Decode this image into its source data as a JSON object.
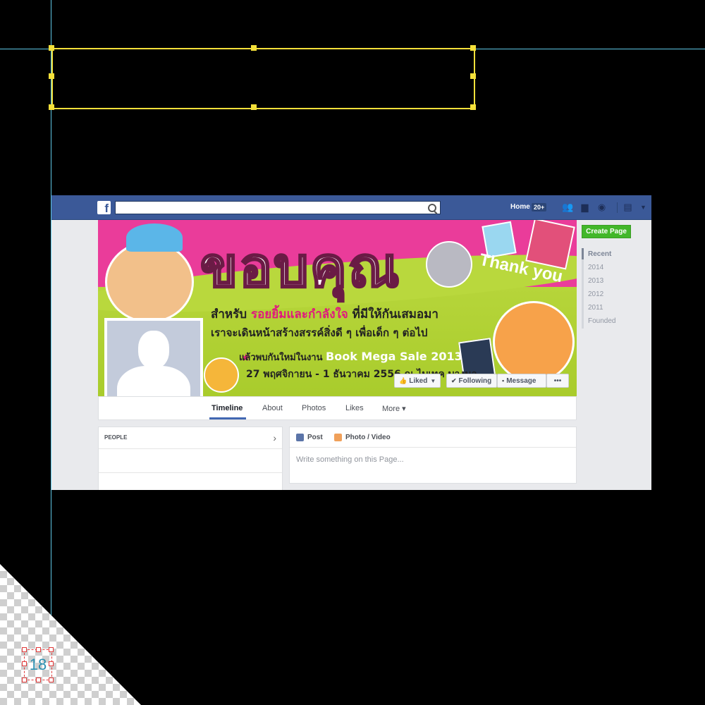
{
  "facebook": {
    "search": {
      "placeholder": ""
    },
    "nav": {
      "home": "Home",
      "badge": "20+"
    },
    "cover": {
      "headline": "ขอบคุณ",
      "thank_you": "Thank you",
      "line1_a": "สำหรับ ",
      "line1_b": "รอยยิ้มและกำลังใจ",
      "line1_c": " ที่มีให้กันเสมอมา",
      "line2": "เราจะเดินหน้าสร้างสรรค์สิ่งดี ๆ เพื่อเด็ก ๆ ต่อไป",
      "line3_a": "แล้วพบกันใหม่ในงาน ",
      "line3_b": "Book Mega Sale 2013",
      "line4": "27 พฤศจิกายน - 1 ธันวาคม 2556 ณ ไบเทค บางนา"
    },
    "buttons": {
      "liked": "Liked",
      "following": "Following",
      "message": "Message",
      "more_dots": "•••"
    },
    "tabs": [
      "Timeline",
      "About",
      "Photos",
      "Likes",
      "More ▾"
    ],
    "people": {
      "title": "PEOPLE"
    },
    "composer": {
      "post": "Post",
      "photo_video": "Photo / Video",
      "placeholder": "Write something on this Page..."
    },
    "sidebar": {
      "create_page": "Create Page",
      "years": [
        "Recent",
        "2014",
        "2013",
        "2012",
        "2011",
        "Founded"
      ]
    }
  },
  "editor": {
    "artboard_number": "18"
  },
  "colors": {
    "fb_blue": "#3b5998",
    "cover_pink": "#ea3c9a",
    "cover_green": "#b6d53a",
    "guide": "#5fc8e6",
    "selection": "#f4e03a"
  }
}
